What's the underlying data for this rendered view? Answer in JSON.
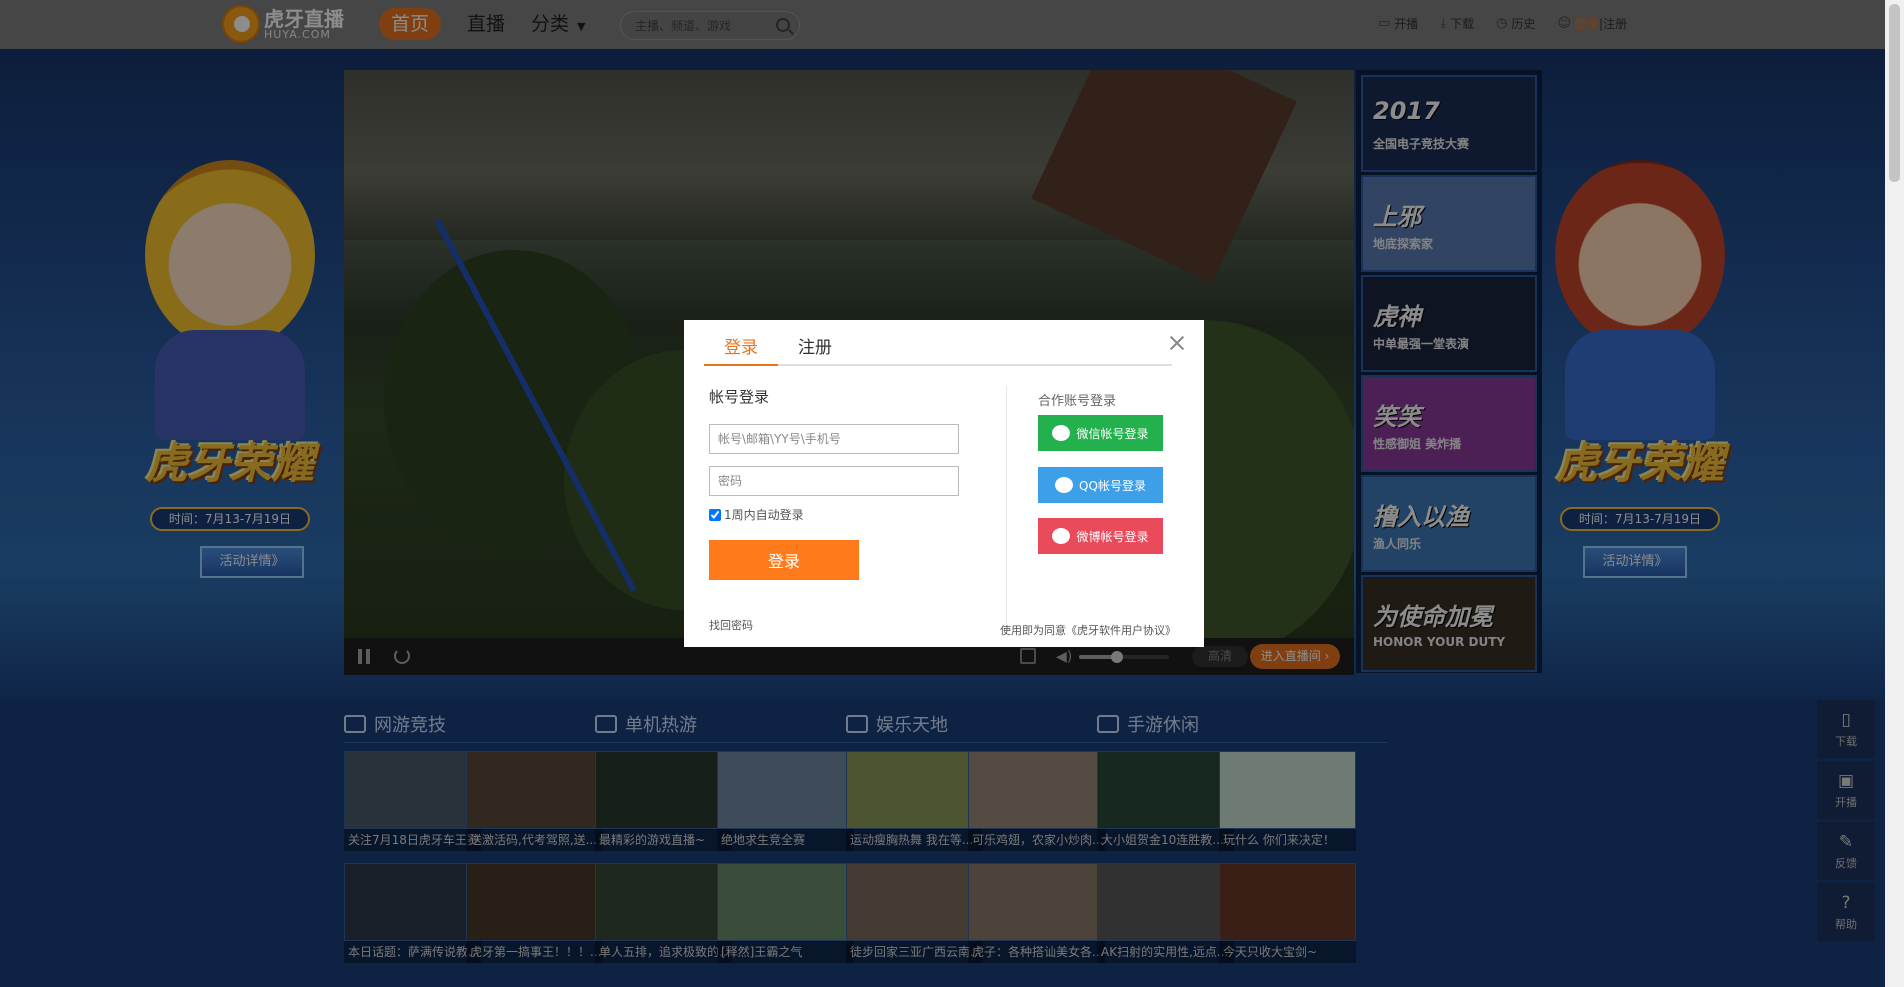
{
  "header": {
    "logo_cn": "虎牙直播",
    "logo_en": "HUYA.COM",
    "nav": [
      {
        "label": "首页",
        "active": true
      },
      {
        "label": "直播",
        "active": false
      },
      {
        "label": "分类",
        "active": false
      }
    ],
    "search_placeholder": "主播、频道、游戏",
    "tools": [
      "开播",
      "下载",
      "历史"
    ],
    "login": "登录",
    "sep": " | ",
    "register": "注册"
  },
  "banners": {
    "title": "虎牙荣耀",
    "date": "时间：7月13-7月19日",
    "button": "活动详情》"
  },
  "player": {
    "quality": "高清",
    "enter_room": "进入直播间 ›",
    "volume_level": 0.42
  },
  "thumbs": [
    {
      "title": "2017",
      "subtitle": "全国电子竞技大赛",
      "color": "#1a2c55"
    },
    {
      "title": "上邪",
      "subtitle": "地底探索家",
      "color": "#5a7db5"
    },
    {
      "title": "虎神",
      "subtitle": "中单最强一堂表演",
      "color": "#1d2640"
    },
    {
      "title": "笑笑",
      "subtitle": "性感御姐 美炸播",
      "color": "#8a3a9c"
    },
    {
      "title": "撸入以渔",
      "subtitle": "渔人同乐",
      "color": "#3e7ab8"
    },
    {
      "title": "为使命加冕",
      "subtitle": "HONOR YOUR DUTY",
      "color": "#3a3024"
    }
  ],
  "modal": {
    "tabs": [
      "登录",
      "注册"
    ],
    "account_title": "帐号登录",
    "username_placeholder": "帐号\\邮箱\\YY号\\手机号",
    "password_placeholder": "密码",
    "remember": "1周内自动登录",
    "login_button": "登录",
    "forgot": "找回密码",
    "partner_title": "合作账号登录",
    "wechat": "微信帐号登录",
    "qq": "QQ帐号登录",
    "weibo": "微博帐号登录",
    "agreement": "使用即为同意《虎牙软件用户协议》"
  },
  "categories": [
    {
      "name": "网游竞技",
      "cards": [
        "关注7月18日虎牙车王赛",
        "送激活码,代考驾照,送...",
        "本日话题：萨满传说教...",
        "虎牙第一搞事王！！！..."
      ],
      "colors": [
        "#4a5b6c",
        "#5d4a3a",
        "#2e3a4a",
        "#4a3a2a"
      ]
    },
    {
      "name": "单机热游",
      "cards": [
        "最精彩的游戏直播~",
        "绝地求生竞全赛",
        "单人五排，追求极致的...",
        "[释然]王霸之气"
      ],
      "colors": [
        "#2a3a2e",
        "#6f8aa0",
        "#3a4a3a",
        "#6a8a6a"
      ]
    },
    {
      "name": "娱乐天地",
      "cards": [
        "运动瘦胸热舞 我在等...",
        "可乐鸡翅，农家小炒肉...",
        "徒步回家三亚广西云南...",
        "虎子：各种搭讪美女各..."
      ],
      "colors": [
        "#8a9a5a",
        "#9a8a7a",
        "#7a6a5a",
        "#8a7a6a"
      ]
    },
    {
      "name": "手游休闲",
      "cards": [
        "大小姐贺金10连胜教...",
        "玩什么 你们来决定！",
        "AK扫射的实用性,远点...",
        "今天只收大宝剑~"
      ],
      "colors": [
        "#2a4a3a",
        "#c8e0d0",
        "#5a5a5a",
        "#6a3a2a"
      ]
    }
  ],
  "side": [
    "下载",
    "开播",
    "反馈",
    "帮助"
  ]
}
